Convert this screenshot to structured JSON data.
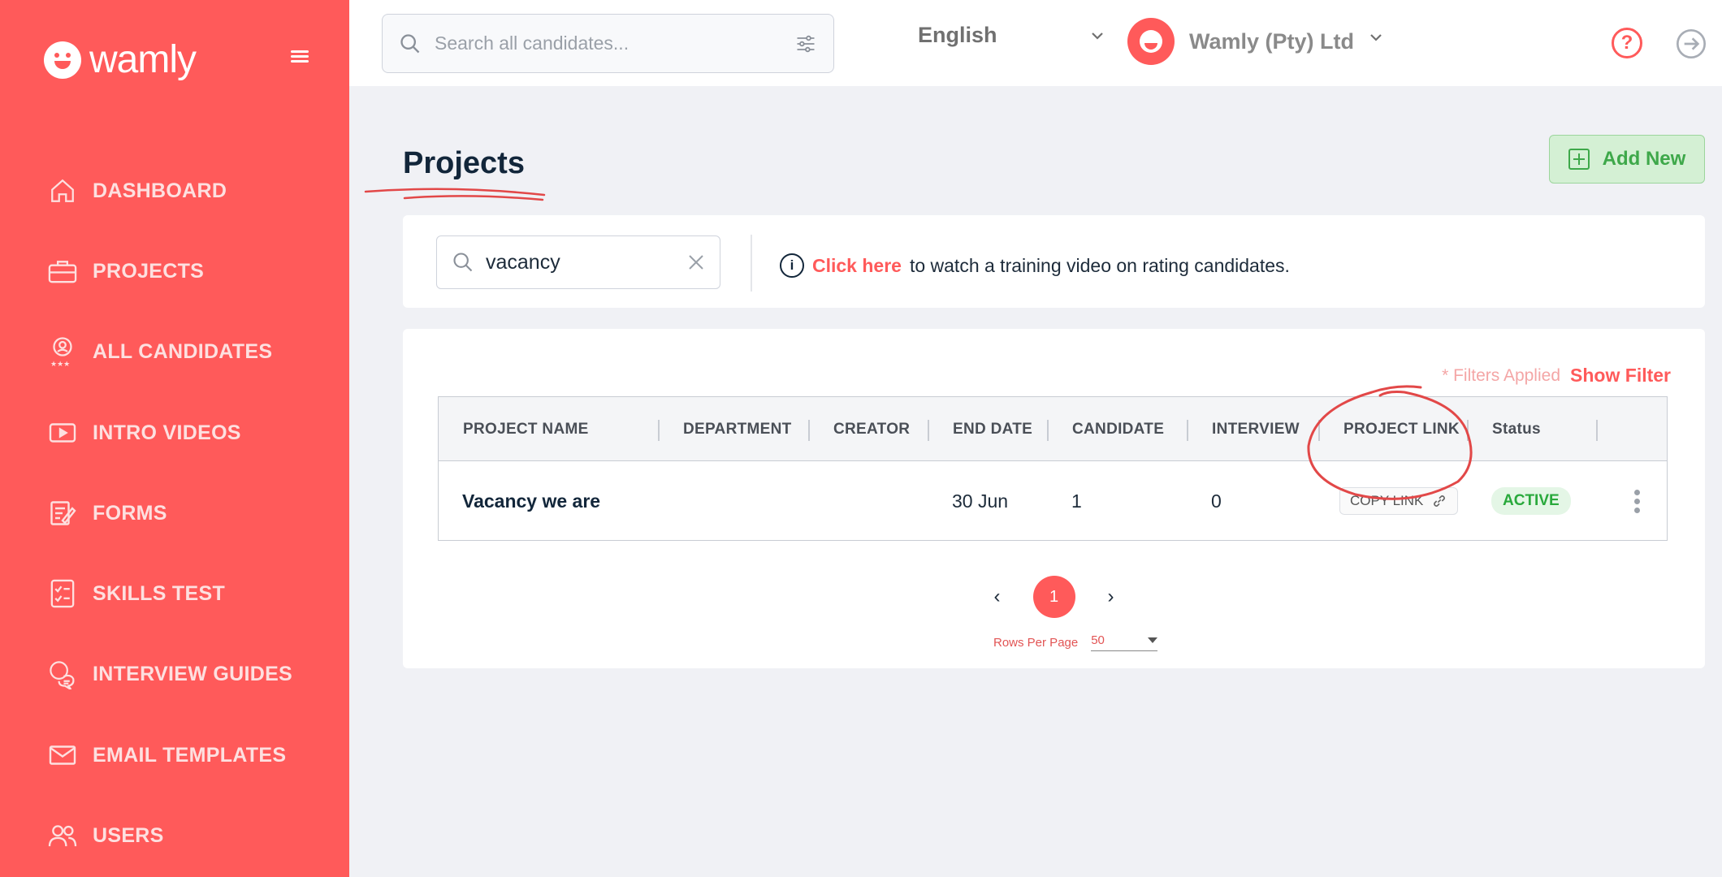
{
  "brand": {
    "name": "wamly"
  },
  "sidebar": {
    "items": [
      {
        "label": "DASHBOARD",
        "icon": "home-icon"
      },
      {
        "label": "PROJECTS",
        "icon": "briefcase-icon"
      },
      {
        "label": "ALL CANDIDATES",
        "icon": "candidate-award-icon"
      },
      {
        "label": "INTRO VIDEOS",
        "icon": "video-play-icon"
      },
      {
        "label": "FORMS",
        "icon": "form-edit-icon"
      },
      {
        "label": "SKILLS TEST",
        "icon": "checklist-icon"
      },
      {
        "label": "INTERVIEW GUIDES",
        "icon": "chat-bubbles-icon"
      },
      {
        "label": "EMAIL TEMPLATES",
        "icon": "envelope-icon"
      },
      {
        "label": "USERS",
        "icon": "users-icon"
      }
    ]
  },
  "header": {
    "search_placeholder": "Search all candidates...",
    "language": "English",
    "company": "Wamly (Pty) Ltd"
  },
  "main": {
    "title": "Projects",
    "add_new": "Add New",
    "project_search_value": "vacancy",
    "training": {
      "link": "Click here",
      "text": "to watch a training video on rating candidates."
    },
    "filters_applied": "* Filters Applied",
    "show_filter": "Show Filter",
    "columns": [
      "PROJECT NAME",
      "DEPARTMENT",
      "CREATOR",
      "END DATE",
      "CANDIDATE",
      "INTERVIEW",
      "PROJECT LINK",
      "Status"
    ],
    "rows": [
      {
        "name": "Vacancy we are",
        "department": "",
        "creator": "",
        "end_date": "30 Jun",
        "candidate": "1",
        "interview": "0",
        "link_label": "COPY LINK",
        "status": "ACTIVE"
      }
    ],
    "pager": {
      "current": "1",
      "prev": "‹",
      "next": "›"
    },
    "rows_per_page": {
      "label": "Rows Per Page",
      "value": "50"
    }
  },
  "colors": {
    "brand": "#ff5a5a",
    "success": "#29a93c",
    "title": "#12263a"
  }
}
